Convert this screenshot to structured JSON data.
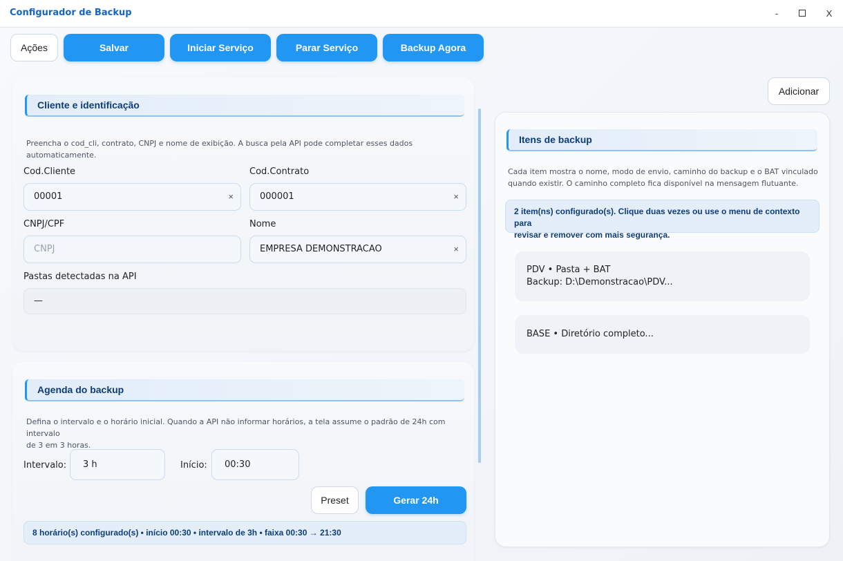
{
  "window": {
    "title": "Configurador de Backup",
    "minimize": "-",
    "close": "X"
  },
  "toolbar": {
    "actions": "Ações",
    "save": "Salvar",
    "start_service": "Iniciar Serviço",
    "stop_service": "Parar Serviço",
    "backup_now": "Backup Agora"
  },
  "client": {
    "title": "Cliente e identificação",
    "hint": "Preencha o cod_cli, contrato, CNPJ e nome de exibição. A busca pela API pode completar esses dados automaticamente.",
    "cod_cliente_label": "Cod.Cliente",
    "cod_cliente_value": "00001",
    "cod_contrato_label": "Cod.Contrato",
    "cod_contrato_value": "000001",
    "cnpj_label": "CNPJ/CPF",
    "cnpj_placeholder": "CNPJ",
    "nome_label": "Nome",
    "nome_value": "EMPRESA DEMONSTRACAO",
    "pastas_label": "Pastas detectadas na API",
    "pastas_value": "—",
    "clear_symbol": "×"
  },
  "schedule": {
    "title": "Agenda do backup",
    "hint_line1": "Defina o intervalo e o horário inicial. Quando a API não informar horários, a tela assume o padrão de 24h com intervalo",
    "hint_line2": "de 3 em 3 horas.",
    "interval_label": "Intervalo:",
    "interval_value": "3 h",
    "start_label": "Início:",
    "start_value": "00:30",
    "preset": "Preset",
    "generate": "Gerar 24h",
    "summary": "8 horário(s) configurado(s) • início 00:30 • intervalo de 3h • faixa 00:30 → 21:30"
  },
  "items": {
    "add": "Adicionar",
    "title": "Itens de backup",
    "hint_line1": "Cada item mostra o nome, modo de envio, caminho do backup e o BAT vinculado",
    "hint_line2": "quando existir. O caminho completo fica disponível na mensagem flutuante.",
    "info_line1": "2 item(ns) configurado(s). Clique duas vezes ou use o menu de contexto para",
    "info_line2": "revisar e remover com mais segurança.",
    "list": [
      {
        "line1": "PDV  •  Pasta + BAT",
        "line2": "Backup: D:\\Demonstracao\\PDV..."
      },
      {
        "line1": "BASE  •  Diretório completo...",
        "line2": ""
      }
    ]
  },
  "colors": {
    "accent": "#2196f3",
    "title": "#1565c0",
    "heading": "#0d3c7a"
  }
}
